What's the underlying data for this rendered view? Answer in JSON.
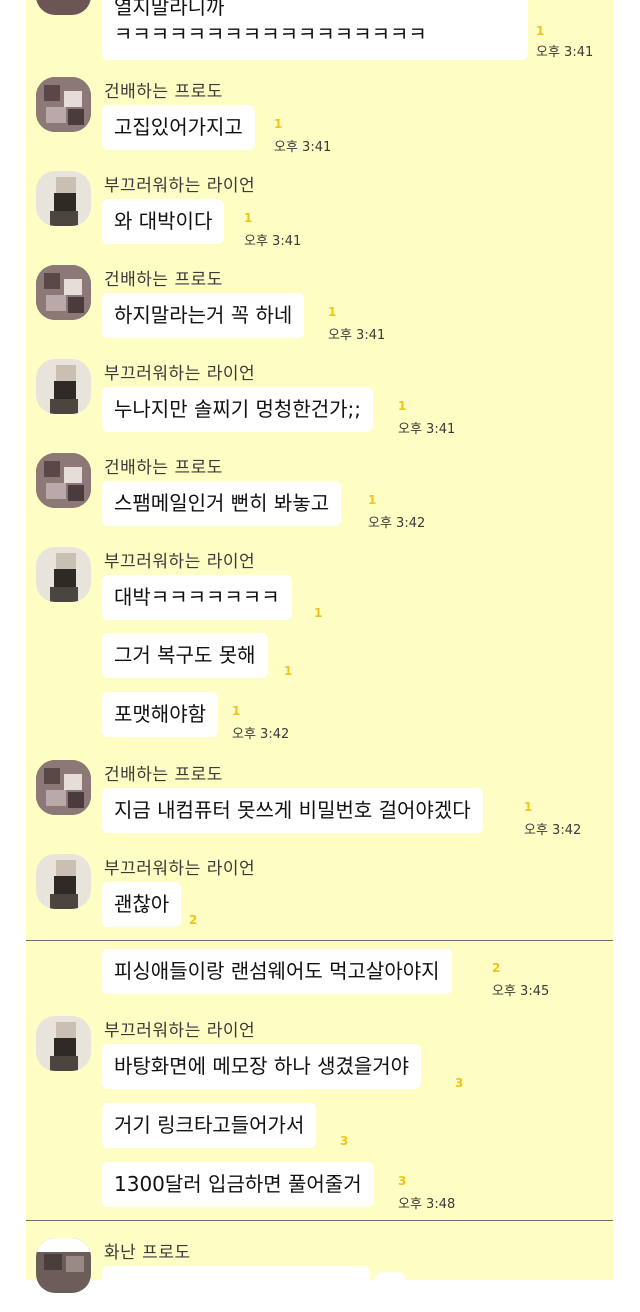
{
  "messages": {
    "m0_line1": "열지말라니까",
    "m0_line2": "ㅋㅋㅋㅋㅋㅋㅋㅋㅋㅋㅋㅋㅋㅋㅋㅋㅋ",
    "m0_unread": "1",
    "m0_time": "오후 3:41",
    "g1_name": "건배하는 프로도",
    "m1_text": "고집있어가지고",
    "m1_unread": "1",
    "m1_time": "오후 3:41",
    "g2_name": "부끄러워하는 라이언",
    "m2_text": "와 대박이다",
    "m2_unread": "1",
    "m2_time": "오후 3:41",
    "g3_name": "건배하는 프로도",
    "m3_text": "하지말라는거 꼭 하네",
    "m3_unread": "1",
    "m3_time": "오후 3:41",
    "g4_name": "부끄러워하는 라이언",
    "m4_text": "누나지만 솔찌기 멍청한건가;;",
    "m4_unread": "1",
    "m4_time": "오후 3:41",
    "g5_name": "건배하는 프로도",
    "m5_text": "스팸메일인거 뻔히 봐놓고",
    "m5_unread": "1",
    "m5_time": "오후 3:42",
    "g6_name": "부끄러워하는 라이언",
    "m6a_text": "대박ㅋㅋㅋㅋㅋㅋㅋ",
    "m6a_unread": "1",
    "m6b_text": "그거 복구도 못해",
    "m6b_unread": "1",
    "m6c_text": "포맷해야함",
    "m6c_unread": "1",
    "m6c_time": "오후 3:42",
    "g7_name": "건배하는 프로도",
    "m7_text": "지금 내컴퓨터 못쓰게 비밀번호 걸어야겠다",
    "m7_unread": "1",
    "m7_time": "오후 3:42",
    "g8_name": "부끄러워하는 라이언",
    "m8_text": "괜찮아",
    "m8_unread": "2",
    "m9_text": "피싱애들이랑 랜섬웨어도 먹고살아야지",
    "m9_unread": "2",
    "m9_time": "오후 3:45",
    "g10_name": "부끄러워하는 라이언",
    "m10a_text": "바탕화면에 메모장 하나 생겼을거야",
    "m10a_unread": "3",
    "m10b_text": "거기 링크타고들어가서",
    "m10b_unread": "3",
    "m10c_text": "1300달러 입금하면 풀어줄거",
    "m10c_unread": "3",
    "m10c_time": "오후 3:48",
    "g11_name": "화난 프로도"
  },
  "colors": {
    "chat_background": "#fefdc3",
    "bubble": "#ffffff",
    "unread_count": "#f0c419",
    "divider": "#6e6e68"
  },
  "icons": {
    "avatar_frodo": "frodo-avatar-icon",
    "avatar_ryan": "ryan-avatar-icon"
  }
}
